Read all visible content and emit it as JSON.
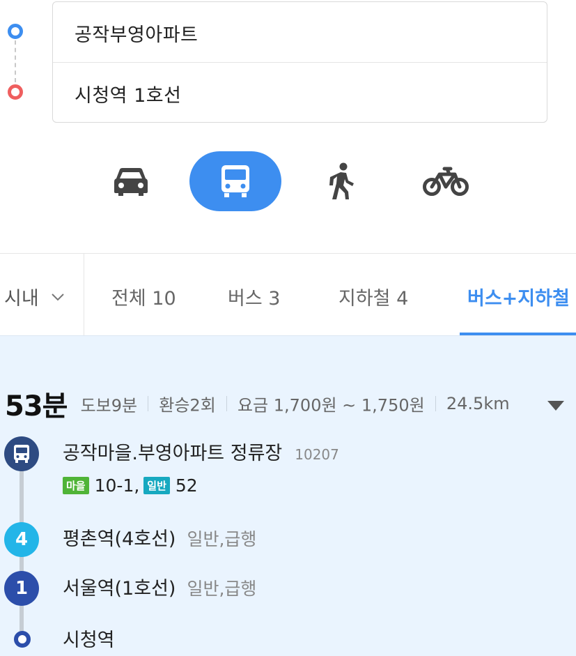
{
  "route": {
    "origin": "공작부영아파트",
    "destination": "시청역 1호선"
  },
  "modes": [
    {
      "name": "car-icon",
      "active": false
    },
    {
      "name": "bus-icon",
      "active": true
    },
    {
      "name": "walk-icon",
      "active": false
    },
    {
      "name": "bike-icon",
      "active": false
    }
  ],
  "tabs": {
    "region": "시내",
    "items": [
      {
        "label": "전체 10",
        "active": false
      },
      {
        "label": "버스 3",
        "active": false
      },
      {
        "label": "지하철 4",
        "active": false
      },
      {
        "label": "버스+지하철",
        "active": true
      }
    ]
  },
  "result": {
    "total_time": "53분",
    "walk": "도보9분",
    "transfers": "환승2회",
    "fare": "요금 1,700원 ~ 1,750원",
    "distance": "24.5km",
    "steps": [
      {
        "name": "공작마을.부영아파트 정류장",
        "stop_id": "10207"
      },
      {
        "name": "평촌역(4호선)",
        "line_number": "4",
        "type": "일반,급행"
      },
      {
        "name": "서울역(1호선)",
        "line_number": "1",
        "type": "일반,급행"
      },
      {
        "name": "시청역"
      }
    ],
    "bus_lines": {
      "badge1": "마을",
      "line1": "10-1,",
      "badge2": "일반",
      "line2": "52"
    }
  },
  "colors": {
    "accent": "#3d8ef0",
    "origin_pin": "#3d8ef0",
    "destination_pin": "#ef5f5f",
    "bus_node": "#2e4b82",
    "line4": "#23b5e8",
    "line1": "#2c4eaa",
    "village_badge": "#4fb437",
    "general_badge": "#17a9c0",
    "result_bg": "#eaf4fe"
  }
}
